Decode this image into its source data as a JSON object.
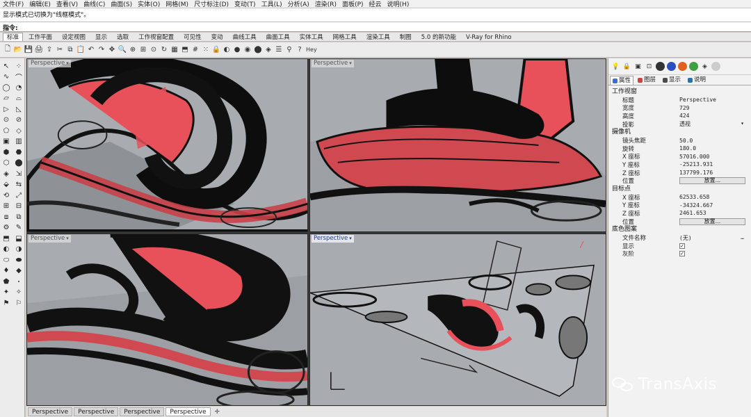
{
  "menu": [
    "文件(F)",
    "编辑(E)",
    "查看(V)",
    "曲线(C)",
    "曲面(S)",
    "实体(O)",
    "网格(M)",
    "尺寸标注(D)",
    "变动(T)",
    "工具(L)",
    "分析(A)",
    "渲染(R)",
    "面板(P)",
    "经云",
    "说明(H)"
  ],
  "history_text": "显示模式已切换为\"线框模式\"。",
  "command_prompt": "指令:",
  "tool_tabs": [
    "标准",
    "工作平面",
    "设定视图",
    "显示",
    "选取",
    "工作视窗配置",
    "可见性",
    "变动",
    "曲线工具",
    "曲面工具",
    "实体工具",
    "网格工具",
    "渲染工具",
    "制图",
    "5.0 的新功能",
    "V-Ray for Rhino"
  ],
  "toolbar_icons": [
    "new-icon",
    "open-icon",
    "save-icon",
    "print-icon",
    "import-icon",
    "cut-icon",
    "copy-icon",
    "paste-icon",
    "undo-icon",
    "redo-icon",
    "pan-icon",
    "zoom-icon",
    "zoom-window-icon",
    "zoom-extents-icon",
    "zoom-selected-icon",
    "rotate-view-icon",
    "viewport-layout-icon",
    "cplane-icon",
    "grid-icon",
    "points-icon",
    "lock-icon",
    "shade-icon",
    "render-icon",
    "material-icon",
    "sphere-icon",
    "layer-icon",
    "properties-icon",
    "filter-icon",
    "help-icon"
  ],
  "toolbar_hey": "Hey",
  "viewports": [
    {
      "label": "Perspective",
      "active": false
    },
    {
      "label": "Perspective",
      "active": false
    },
    {
      "label": "Perspective",
      "active": false
    },
    {
      "label": "Perspective",
      "active": true
    }
  ],
  "bottom_tabs": [
    "Perspective",
    "Perspective",
    "Perspective",
    "Perspective"
  ],
  "panel_tabs": [
    "属性",
    "图层",
    "显示",
    "说明"
  ],
  "props": {
    "viewport_section": "工作视窗",
    "title_label": "标题",
    "title_value": "Perspective",
    "width_label": "宽度",
    "width_value": "729",
    "height_label": "高度",
    "height_value": "424",
    "projection_label": "投影",
    "projection_value": "透视",
    "camera_section": "摄像机",
    "lens_label": "镜头焦距",
    "lens_value": "50.0",
    "rotation_label": "旋转",
    "rotation_value": "180.0",
    "cam_x_label": "X 座标",
    "cam_x_value": "57016.000",
    "cam_y_label": "Y 座标",
    "cam_y_value": "-25213.931",
    "cam_z_label": "Z 座标",
    "cam_z_value": "137799.176",
    "cam_pos_label": "位置",
    "place_button": "放置...",
    "target_section": "目标点",
    "tgt_x_label": "X 座标",
    "tgt_x_value": "62533.658",
    "tgt_y_label": "Y 座标",
    "tgt_y_value": "-34324.667",
    "tgt_z_label": "Z 座标",
    "tgt_z_value": "2461.653",
    "tgt_pos_label": "位置",
    "place_button2": "放置...",
    "wallpaper_section": "底色图案",
    "file_label": "文件名称",
    "file_value": "(无)",
    "show_label": "显示",
    "gray_label": "灰阶"
  },
  "watermark": "TransAxis",
  "colors": {
    "accent_red": "#e8505a",
    "viewport_bg": "#a8acb0"
  }
}
